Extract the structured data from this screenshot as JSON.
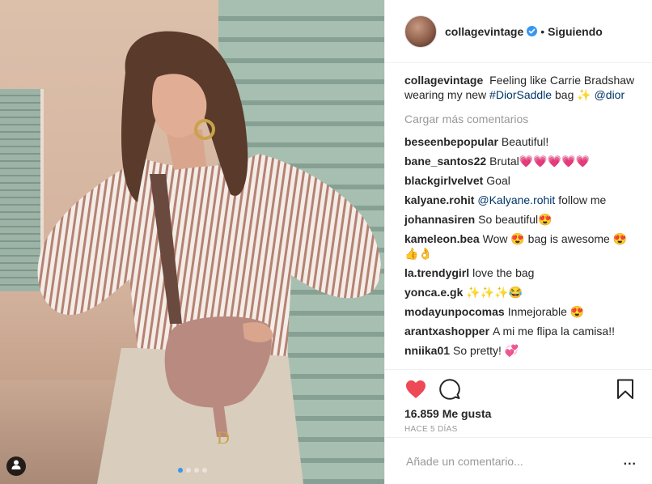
{
  "header": {
    "username": "collagevintage",
    "separator": "•",
    "follow_label": "Siguiendo"
  },
  "caption": {
    "username": "collagevintage",
    "text": "Feeling like Carrie Bradshaw wearing my new",
    "hashtag": "#DiorSaddle",
    "text2": "bag ✨",
    "mention": "@dior"
  },
  "load_more_label": "Cargar más comentarios",
  "comments": [
    {
      "user": "beseenbepopular",
      "text": "Beautiful!"
    },
    {
      "user": "bane_santos22",
      "text": "Brutal💗💗💗💗💗"
    },
    {
      "user": "blackgirlvelvet",
      "text": "Goal"
    },
    {
      "user": "kalyane.rohit",
      "mention": "@Kalyane.rohit",
      "text": "follow me"
    },
    {
      "user": "johannasiren",
      "text": "So beautiful😍"
    },
    {
      "user": "kameleon.bea",
      "text": "Wow 😍 bag is awesome 😍 👍👌"
    },
    {
      "user": "la.trendygirl",
      "text": "love the bag"
    },
    {
      "user": "yonca.e.gk",
      "text": "✨✨✨😂"
    },
    {
      "user": "modayunpocomas",
      "text": "Inmejorable 😍"
    },
    {
      "user": "arantxashopper",
      "text": "A mi me flipa la camisa!!"
    },
    {
      "user": "nniika01",
      "text": "So pretty! 💞"
    }
  ],
  "likes_label": "16.859 Me gusta",
  "time_label": "HACE 5 DÍAS",
  "add_comment_placeholder": "Añade un comentario...",
  "more_label": "...",
  "carousel": {
    "count": 4,
    "active": 1
  },
  "colors": {
    "like_red": "#ed4956",
    "verified_blue": "#3897f0",
    "link_blue": "#003569",
    "muted_grey": "#999999"
  },
  "icons": [
    "heart-icon",
    "comment-icon",
    "bookmark-icon",
    "verified-badge-icon",
    "user-tag-icon"
  ]
}
